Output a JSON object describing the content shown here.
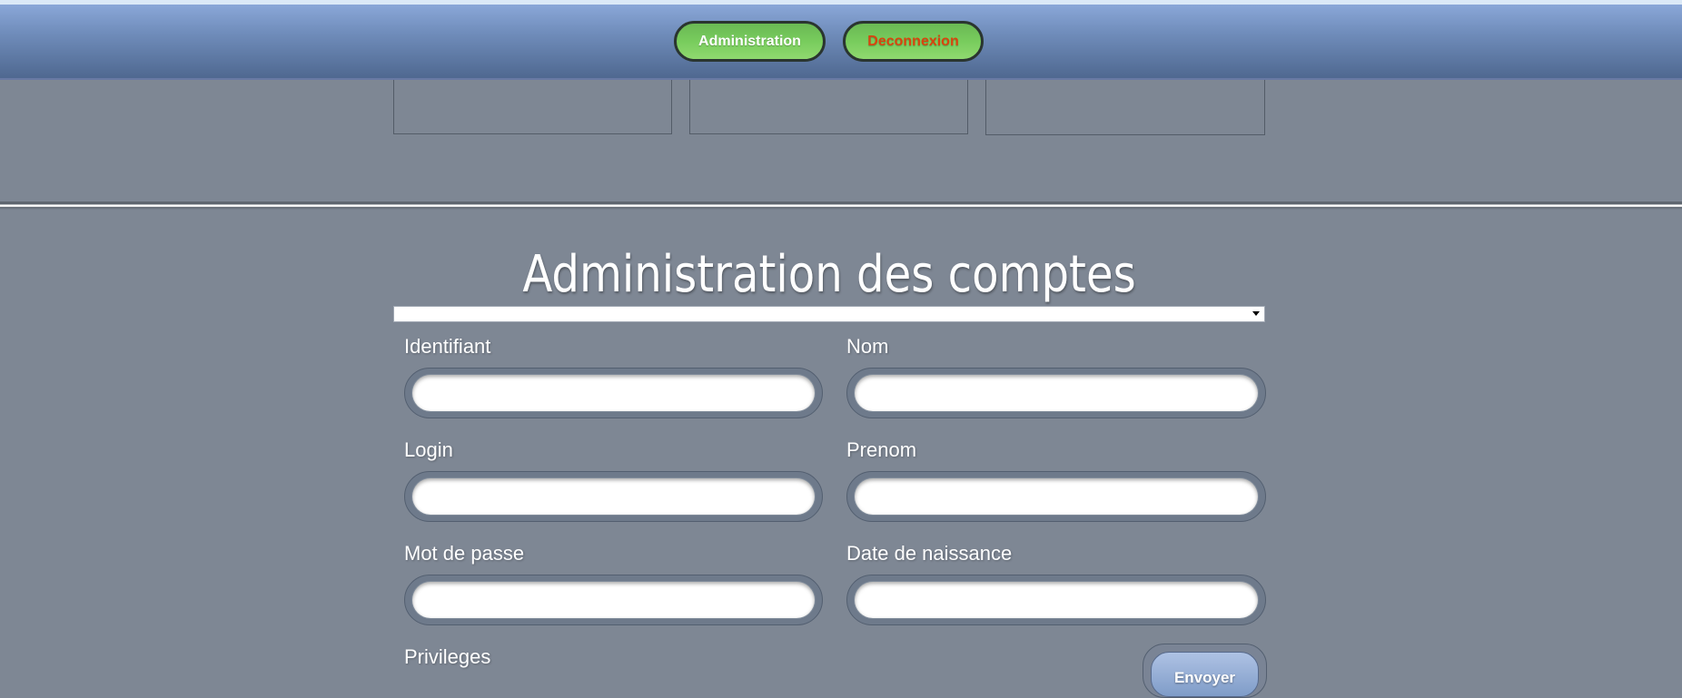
{
  "nav": {
    "admin_label": "Administration",
    "logout_label": "Deconnexion"
  },
  "colors": {
    "nav_button_green": "#78cc5d",
    "logout_text": "#d9440e",
    "page_background": "#7e8794",
    "navbar_top": "#8aa7d8",
    "navbar_bottom": "#4f6890"
  },
  "main": {
    "title": "Administration des comptes",
    "account_select": {
      "selected": ""
    },
    "fields": {
      "identifiant": {
        "label": "Identifiant",
        "value": ""
      },
      "nom": {
        "label": "Nom",
        "value": ""
      },
      "login": {
        "label": "Login",
        "value": ""
      },
      "prenom": {
        "label": "Prenom",
        "value": ""
      },
      "mot_de_passe": {
        "label": "Mot de passe",
        "value": ""
      },
      "date_naissance": {
        "label": "Date de naissance",
        "value": ""
      },
      "privileges": {
        "label": "Privileges"
      }
    },
    "submit_label": "Envoyer"
  }
}
